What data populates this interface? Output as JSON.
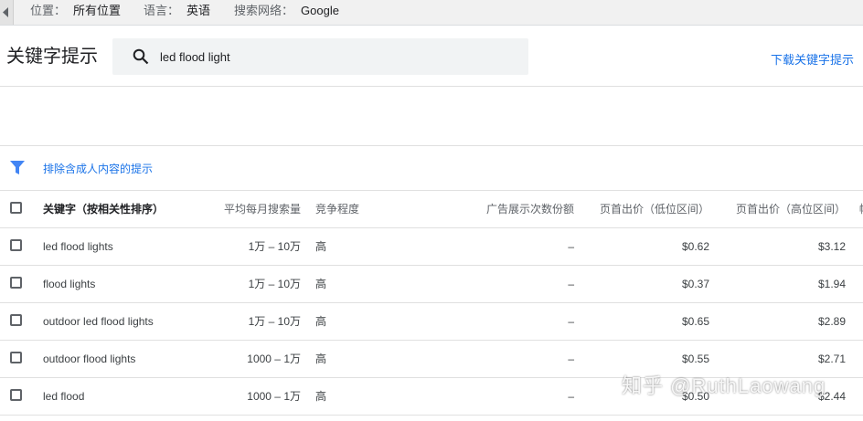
{
  "topbar": {
    "location_label": "位置：",
    "location_value": "所有位置",
    "language_label": "语言：",
    "language_value": "英语",
    "network_label": "搜索网络：",
    "network_value": "Google"
  },
  "header": {
    "title": "关键字提示",
    "search_value": "led flood light",
    "download_label": "下载关键字提示"
  },
  "filter": {
    "label": "排除含成人内容的提示"
  },
  "table": {
    "columns": {
      "keyword": "关键字（按相关性排序）",
      "avg_monthly": "平均每月搜索量",
      "competition": "竞争程度",
      "impression_share": "广告展示次数份额",
      "bid_low": "页首出价（低位区间）",
      "bid_high": "页首出价（高位区间）",
      "more": "帐"
    },
    "rows": [
      {
        "keyword": "led flood lights",
        "avg_monthly": "1万 – 10万",
        "competition": "高",
        "impression_share": "–",
        "bid_low": "$0.62",
        "bid_high": "$3.12"
      },
      {
        "keyword": "flood lights",
        "avg_monthly": "1万 – 10万",
        "competition": "高",
        "impression_share": "–",
        "bid_low": "$0.37",
        "bid_high": "$1.94"
      },
      {
        "keyword": "outdoor led flood lights",
        "avg_monthly": "1万 – 10万",
        "competition": "高",
        "impression_share": "–",
        "bid_low": "$0.65",
        "bid_high": "$2.89"
      },
      {
        "keyword": "outdoor flood lights",
        "avg_monthly": "1000 – 1万",
        "competition": "高",
        "impression_share": "–",
        "bid_low": "$0.55",
        "bid_high": "$2.71"
      },
      {
        "keyword": "led flood",
        "avg_monthly": "1000 – 1万",
        "competition": "高",
        "impression_share": "–",
        "bid_low": "$0.50",
        "bid_high": "$2.44"
      }
    ]
  },
  "watermark": "知乎 @RuthLaowang",
  "colors": {
    "accent": "#1a73e8",
    "filter_icon": "#4285f4"
  }
}
